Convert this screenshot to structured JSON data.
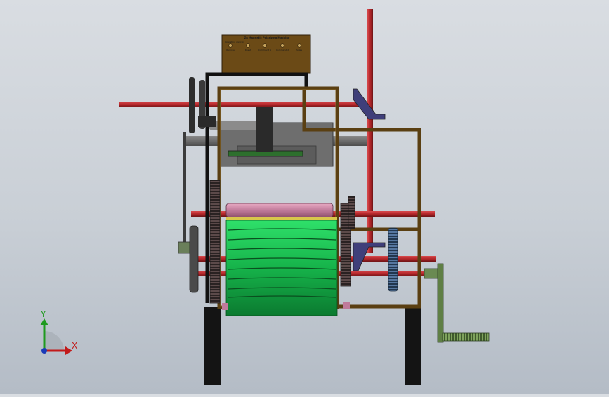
{
  "viewport": {
    "background_colors": [
      "#d9dde2",
      "#b4bcc6"
    ]
  },
  "control_panel": {
    "title": "Zn Magnetic Polarizing Machine",
    "subtitle": "Operating controls",
    "buttons": [
      {
        "label": "Remote"
      },
      {
        "label": "Reset"
      },
      {
        "label": "Command 1"
      },
      {
        "label": "Command 2"
      },
      {
        "label": "Sides"
      }
    ]
  },
  "axis_triad": {
    "y_label": "Y",
    "x_label": "X",
    "colors": {
      "x": "#c21a1a",
      "y": "#1f9a1f",
      "z": "#1a3ab8"
    }
  },
  "model_colors": {
    "frame": "#5a3f12",
    "frame_light": "#6e4f1c",
    "rod": "#b2262a",
    "roller_green": "#16b34a",
    "roller_pink": "#c07a9a",
    "gear_dark": "#3c3c3c",
    "gear_blue": "#3d5a78",
    "crank": "#5f7f45",
    "leg": "#141414",
    "table": "#6b6b6b"
  }
}
